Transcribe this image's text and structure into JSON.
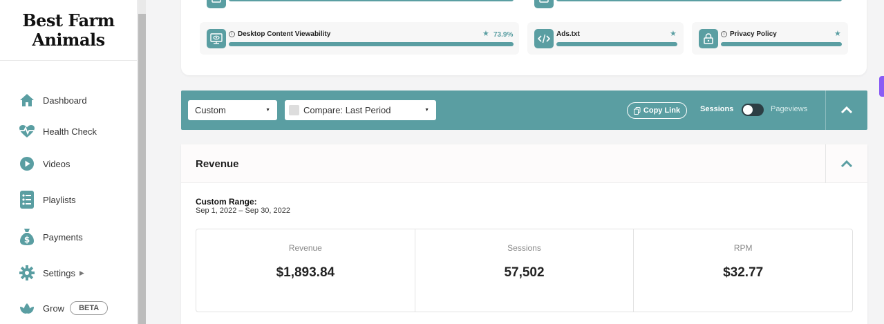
{
  "brand": {
    "logo_line1": "Best Farm",
    "logo_line2": "Animals"
  },
  "sidebar": {
    "items": [
      {
        "label": "Dashboard",
        "icon": "home-icon"
      },
      {
        "label": "Health Check",
        "icon": "heartbeat-icon"
      },
      {
        "label": "Videos",
        "icon": "play-circle-icon"
      },
      {
        "label": "Playlists",
        "icon": "list-icon"
      },
      {
        "label": "Payments",
        "icon": "money-bag-icon"
      },
      {
        "label": "Settings",
        "icon": "gear-icon"
      },
      {
        "label": "Grow",
        "icon": "leaf-icon",
        "badge": "BETA"
      }
    ]
  },
  "health_metrics": [
    {
      "label": "Desktop Content Viewability",
      "value": "73.9%",
      "progress": 1.0
    },
    {
      "label": "Ads.txt",
      "progress": 1.0
    },
    {
      "label": "Privacy Policy",
      "progress": 1.0
    }
  ],
  "filters": {
    "range_select": "Custom",
    "compare_select": "Compare: Last Period",
    "copy_link": "Copy Link",
    "toggle_left": "Sessions",
    "toggle_right": "Pageviews"
  },
  "revenue": {
    "title": "Revenue",
    "range_label": "Custom Range:",
    "range_value": "Sep 1, 2022 – Sep 30, 2022",
    "stats": [
      {
        "label": "Revenue",
        "value": "$1,893.84"
      },
      {
        "label": "Sessions",
        "value": "57,502"
      },
      {
        "label": "RPM",
        "value": "$32.77"
      }
    ]
  },
  "colors": {
    "accent": "#5a9ea2",
    "dark": "#2c3e44",
    "purple": "#8a5cf5"
  }
}
